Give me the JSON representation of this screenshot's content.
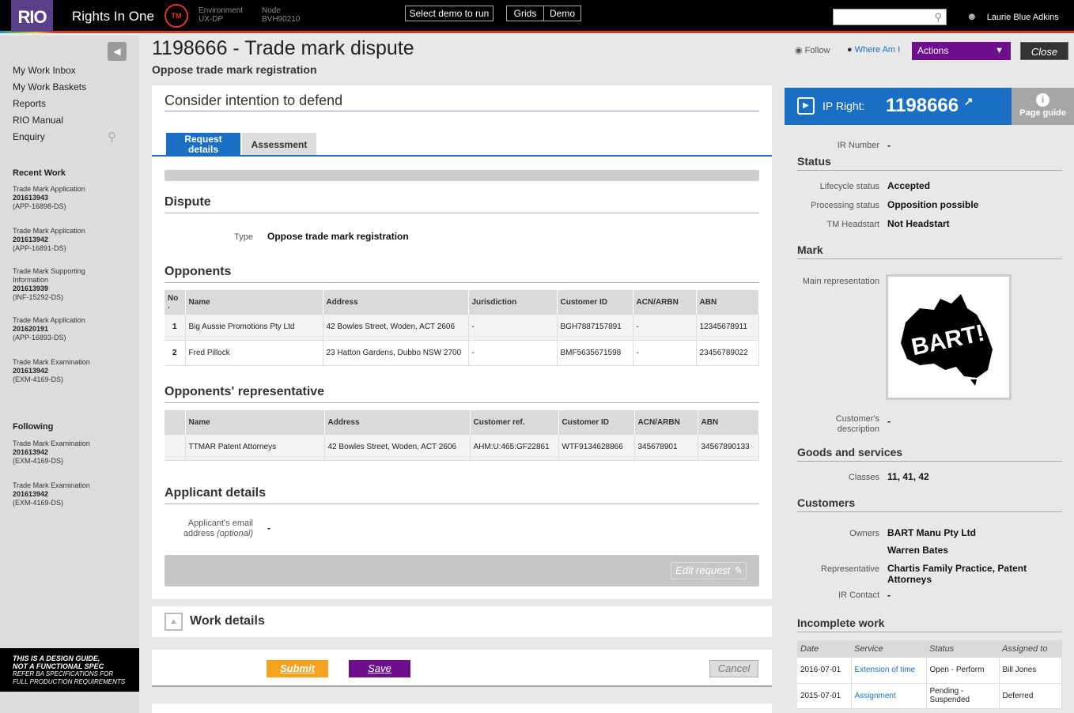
{
  "header": {
    "logo": "RIO",
    "app_name": "Rights In One",
    "tm_badge": "TM",
    "environment_label": "Environment",
    "environment_value": "UX-DP",
    "node_label": "Node",
    "node_value": "BVH90210",
    "select_demo": "Select demo to run",
    "grids": "Grids",
    "demo": "Demo",
    "search_value": "",
    "user_name": "Laurie Blue Adkins"
  },
  "sidebar": {
    "nav": [
      "My Work Inbox",
      "My Work Baskets",
      "Reports",
      "RIO Manual",
      "Enquiry"
    ],
    "recent_heading": "Recent Work",
    "recent": [
      {
        "type": "Trade Mark Application",
        "number": "201613943",
        "ref": "(APP-16898-DS)"
      },
      {
        "type": "Trade Mark Application",
        "number": "201613942",
        "ref": "(APP-16891-DS)"
      },
      {
        "type": "Trade Mark Supporting Information",
        "number": "201613939",
        "ref": "(INF-15292-DS)"
      },
      {
        "type": "Trade Mark Application",
        "number": "201620191",
        "ref": "(APP-16893-DS)"
      },
      {
        "type": "Trade Mark Examination",
        "number": "201613942",
        "ref": "(EXM-4169-DS)"
      }
    ],
    "following_heading": "Following",
    "following": [
      {
        "type": "Trade Mark Examination",
        "number": "201613942",
        "ref": "(EXM-4169-DS)"
      },
      {
        "type": "Trade Mark Examination",
        "number": "201613942",
        "ref": "(EXM-4169-DS)"
      }
    ],
    "disclaimer_line1": "THIS IS A DESIGN GUIDE,",
    "disclaimer_line2": "NOT A FUNCTIONAL SPEC",
    "disclaimer_line3": "REFER BA SPECIFICATIONS FOR",
    "disclaimer_line4": "FULL PRODUCTION REQUIREMENTS"
  },
  "page": {
    "title": "1198666 - Trade mark dispute",
    "subtitle": "Oppose trade mark registration",
    "follow": "Follow",
    "where_am_i": "Where Am I",
    "actions": "Actions",
    "close": "Close"
  },
  "form": {
    "heading": "Consider intention to defend",
    "tab_request_line1": "Request",
    "tab_request_line2": "details",
    "tab_assessment": "Assessment",
    "dispute_heading": "Dispute",
    "type_label": "Type",
    "type_value": "Oppose trade mark registration",
    "opponents_heading": "Opponents",
    "opponents_columns": [
      "No .",
      "Name",
      "Address",
      "Jurisdiction",
      "Customer ID",
      "ACN/ARBN",
      "ABN"
    ],
    "opponents_rows": [
      [
        "1",
        "Big Aussie Promotions Pty Ltd",
        "42 Bowles Street, Woden, ACT 2606",
        "-",
        "BGH7887157891",
        "-",
        "12345678911"
      ],
      [
        "2",
        "Fred Pillock",
        "23 Hatton Gardens, Dubbo NSW 2700",
        "-",
        "BMF5635671598",
        "-",
        "23456789022"
      ]
    ],
    "rep_heading": "Opponents' representative",
    "rep_columns": [
      "",
      "Name",
      "Address",
      "Customer ref.",
      "Customer ID",
      "ACN/ARBN",
      "ABN"
    ],
    "rep_rows": [
      [
        "",
        "TTMAR Patent Attorneys",
        "42 Bowles Street, Woden, ACT 2606",
        "AHM:U:465:GF22861",
        "WTF9134628866",
        "345678901",
        "34567890133"
      ]
    ],
    "applicant_heading": "Applicant details",
    "email_label_line1": "Applicant's email",
    "email_label_line2": "address",
    "email_label_optional": "(optional)",
    "email_value": "-",
    "edit_request": "Edit request",
    "work_details": "Work details",
    "submit": "Submit",
    "save": "Save",
    "cancel": "Cancel"
  },
  "right_panel": {
    "ip_right_label": "IP Right:",
    "ip_right_number": "1198666",
    "page_guide": "Page guide",
    "ir_number_label": "IR Number",
    "ir_number_value": "-",
    "status_heading": "Status",
    "lifecycle_label": "Lifecycle status",
    "lifecycle_value": "Accepted",
    "processing_label": "Processing status",
    "processing_value": "Opposition possible",
    "headstart_label": "TM Headstart",
    "headstart_value": "Not Headstart",
    "mark_heading": "Mark",
    "main_rep_label": "Main representation",
    "mark_text": "BART!",
    "cust_desc_label_line1": "Customer's",
    "cust_desc_label_line2": "description",
    "cust_desc_value": "-",
    "goods_heading": "Goods and services",
    "classes_label": "Classes",
    "classes_value": "11, 41, 42",
    "customers_heading": "Customers",
    "owners_label": "Owners",
    "owner1": "BART Manu Pty Ltd",
    "owner2": "Warren Bates",
    "representative_label": "Representative",
    "representative_line1": "Chartis Family Practice, Patent",
    "representative_line2": "Attorneys",
    "ir_contact_label": "IR Contact",
    "ir_contact_value": "-",
    "incomplete_heading": "Incomplete work",
    "work_columns": [
      "Date",
      "Service",
      "Status",
      "Assigned to"
    ],
    "work_rows": [
      {
        "date": "2016-07-01",
        "service": "Extension of time",
        "status": "Open - Perform",
        "assigned": "Bill Jones"
      },
      {
        "date": "2015-07-01",
        "service": "Assignment",
        "status": "Pending - Suspended",
        "assigned": "Deferred"
      }
    ]
  },
  "colors": {
    "accent_blue": "#1a6fc4",
    "purple": "#6d0f8d",
    "orange": "#f5a21e",
    "top_stripe": "#d63b1f"
  }
}
